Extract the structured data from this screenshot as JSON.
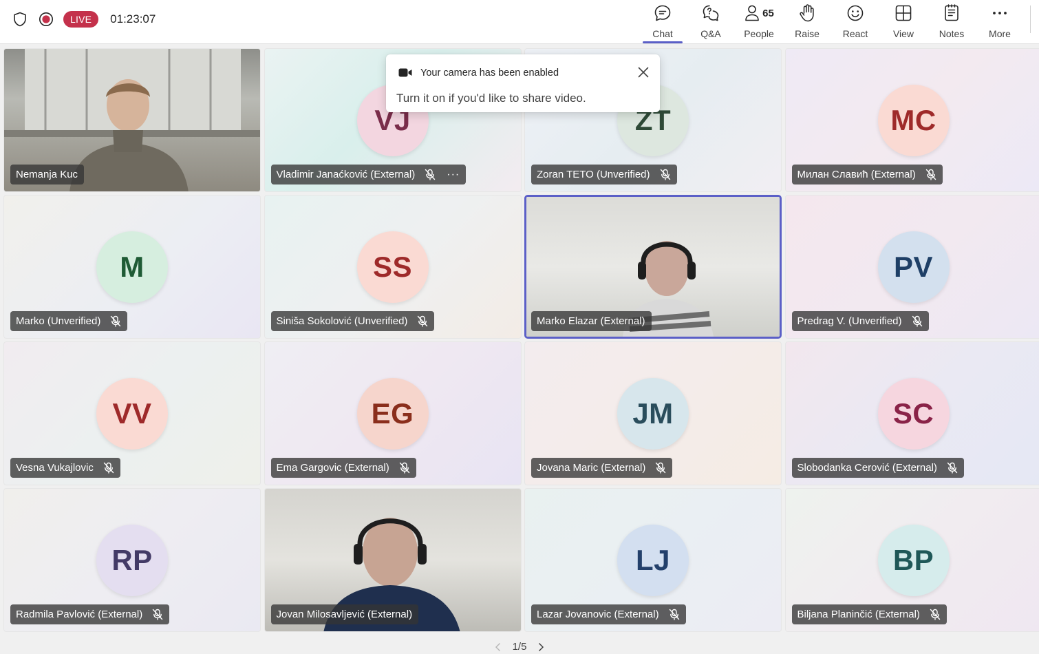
{
  "topbar": {
    "live_label": "LIVE",
    "timer": "01:23:07",
    "actions": [
      {
        "id": "chat",
        "label": "Chat",
        "icon": "chat-icon",
        "active": true
      },
      {
        "id": "qa",
        "label": "Q&A",
        "icon": "qa-icon"
      },
      {
        "id": "people",
        "label": "People",
        "icon": "people-icon",
        "count": "65"
      },
      {
        "id": "raise",
        "label": "Raise",
        "icon": "raise-hand-icon"
      },
      {
        "id": "react",
        "label": "React",
        "icon": "react-icon"
      },
      {
        "id": "view",
        "label": "View",
        "icon": "view-icon"
      },
      {
        "id": "notes",
        "label": "Notes",
        "icon": "notes-icon"
      },
      {
        "id": "more",
        "label": "More",
        "icon": "more-icon"
      }
    ],
    "accent_color": "#5b5fc7",
    "live_color": "#c4314b"
  },
  "toast": {
    "title": "Your camera has been enabled",
    "body": "Turn it on if you'd like to share video."
  },
  "participants": [
    {
      "name": "Nemanja Kuc",
      "video": true,
      "scene": "office",
      "muted": false
    },
    {
      "name": "Vladimir Janaćković (External)",
      "initials": "VJ",
      "avatar_bg": "#f3d6e0",
      "avatar_fg": "#7a2d4a",
      "muted": true,
      "more": "···",
      "bg": "linear-gradient(135deg,#eaf3f2 0%,#d9efec 45%,#f3ecf0 100%)"
    },
    {
      "name": "Zoran TETO (Unverified)",
      "initials": "ZT",
      "avatar_bg": "#dde7df",
      "avatar_fg": "#2e4a37",
      "muted": true,
      "bg": "linear-gradient(135deg,#eef1f6 0%,#e6edf1 50%,#f1eef3 100%)"
    },
    {
      "name": "Милан Славић (External)",
      "initials": "MC",
      "avatar_bg": "#fadad3",
      "avatar_fg": "#9e2a2a",
      "muted": true,
      "bg": "linear-gradient(135deg,#efeaf5 0%,#f3eaf0 50%,#ece9f6 100%)"
    },
    {
      "name": "Marko (Unverified)",
      "initials": "M",
      "avatar_bg": "#d6eedf",
      "avatar_fg": "#1f5b35",
      "muted": true,
      "bg": "linear-gradient(135deg,#f1f0ec 0%,#eceef3 55%,#e9e6f3 100%)"
    },
    {
      "name": "Siniša Sokolović (Unverified)",
      "initials": "SS",
      "avatar_bg": "#fadad3",
      "avatar_fg": "#9e2a2a",
      "muted": true,
      "bg": "linear-gradient(135deg,#e8f2f1 0%,#eef0f1 50%,#f3ece6 100%)"
    },
    {
      "name": "Marko Elazar (External)",
      "video": true,
      "scene": "headset-wall",
      "muted": false,
      "active_speaker": true
    },
    {
      "name": "Predrag V. (Unverified)",
      "initials": "PV",
      "avatar_bg": "#d3e0ee",
      "avatar_fg": "#1e3f66",
      "muted": true,
      "bg": "linear-gradient(135deg,#f4e7ee 0%,#f2e9f0 50%,#ece8f4 100%)"
    },
    {
      "name": "Vesna Vukajlovic",
      "initials": "VV",
      "avatar_bg": "#fadad3",
      "avatar_fg": "#9e2a2a",
      "muted": true,
      "bg": "linear-gradient(135deg,#f1ecf0 0%,#ecf0f0 50%,#eef0ea 100%)"
    },
    {
      "name": "Ema Gargovic (External)",
      "initials": "EG",
      "avatar_bg": "#f6d5cc",
      "avatar_fg": "#8a2e1c",
      "muted": true,
      "bg": "linear-gradient(135deg,#efeef3 0%,#efe8f2 50%,#e8e4f3 100%)"
    },
    {
      "name": "Jovana Maric (External)",
      "initials": "JM",
      "avatar_bg": "#d7e6ec",
      "avatar_fg": "#2a4d5c",
      "muted": true,
      "bg": "linear-gradient(135deg,#f3ecee 0%,#f4ecea 50%,#f5ece4 100%)"
    },
    {
      "name": "Slobodanka Cerović (External)",
      "initials": "SC",
      "avatar_bg": "#f6d6df",
      "avatar_fg": "#8a2348",
      "muted": true,
      "bg": "linear-gradient(135deg,#f2e7ee 0%,#eae9f3 50%,#e5e8f4 100%)"
    },
    {
      "name": "Radmila Pavlović (External)",
      "initials": "RP",
      "avatar_bg": "#e4def0",
      "avatar_fg": "#433a66",
      "muted": true,
      "bg": "linear-gradient(135deg,#f0efec 0%,#eeedf2 50%,#eae9f2 100%)"
    },
    {
      "name": "Jovan Milosavljević (External)",
      "video": true,
      "scene": "headset-blue",
      "muted": false
    },
    {
      "name": "Lazar Jovanovic (External)",
      "initials": "LJ",
      "avatar_bg": "#d3dff0",
      "avatar_fg": "#23406b",
      "muted": true,
      "bg": "linear-gradient(135deg,#e9f1f0 0%,#eaeff3 50%,#ececf3 100%)"
    },
    {
      "name": "Biljana Planinčić (External)",
      "initials": "BP",
      "avatar_bg": "#d6ecec",
      "avatar_fg": "#1f5858",
      "muted": true,
      "bg": "linear-gradient(135deg,#eef2ee 0%,#f1ecf0 50%,#efe7f1 100%)"
    }
  ],
  "pagination": {
    "label": "1/5"
  }
}
